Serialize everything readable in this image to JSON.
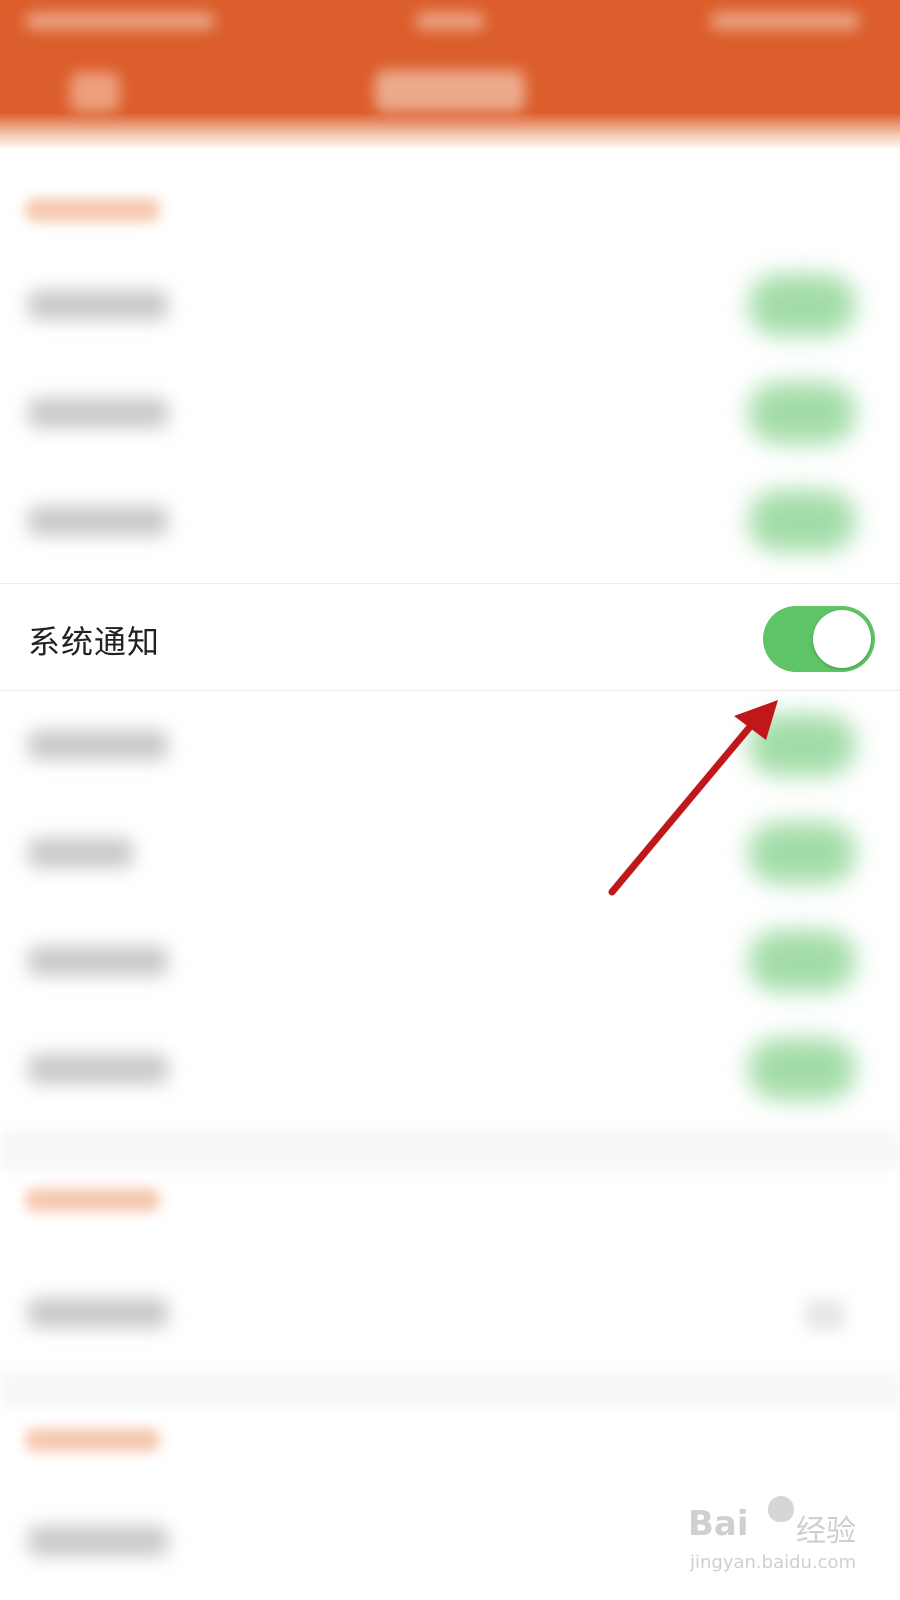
{
  "system_notification": {
    "label": "系统通知",
    "enabled": true,
    "accent_color": "#5fc466"
  },
  "header": {
    "background_color": "#dc5e2c"
  },
  "annotation": {
    "arrow_color": "#c0171b",
    "points_to": "system-notification-toggle"
  },
  "watermark": {
    "brand_latin": "Bai",
    "brand_cn": "经验",
    "url": "jingyan.baidu.com"
  }
}
